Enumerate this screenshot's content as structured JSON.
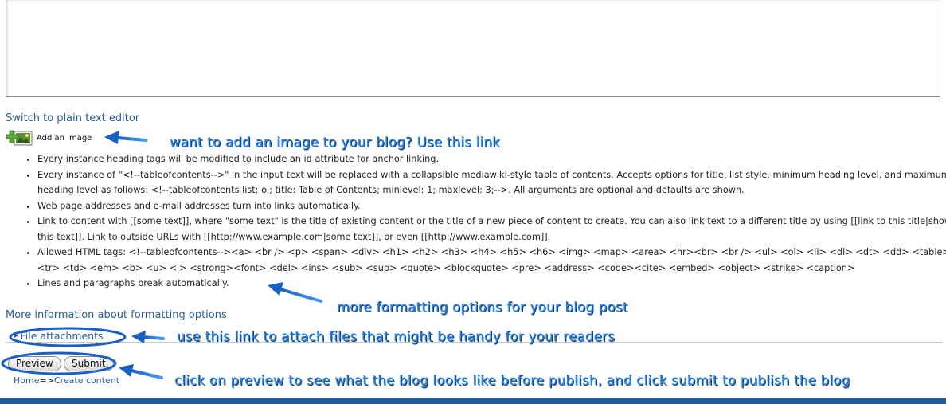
{
  "editor": {
    "switch_link": "Switch to plain text editor",
    "add_image_label": "Add an image"
  },
  "formatting_tips": [
    "Every instance heading tags will be modified to include an id attribute for anchor linking.",
    "Every instance of \"<!--tableofcontents-->\" in the input text will be replaced with a collapsible mediawiki-style table of contents. Accepts options for title, list style, minimum heading level, and maximum heading level as follows: <!--tableofcontents list: ol; title: Table of Contents; minlevel: 1; maxlevel: 3;-->. All arguments are optional and defaults are shown.",
    "Web page addresses and e-mail addresses turn into links automatically.",
    "Link to content with [[some text]], where \"some text\" is the title of existing content or the title of a new piece of content to create. You can also link text to a different title by using [[link to this title|show this text]]. Link to outside URLs with [[http://www.example.com|some text]], or even [[http://www.example.com]].",
    "Allowed HTML tags: <!--tableofcontents--><a> <br /> <p> <span> <div> <h1> <h2> <h3> <h4> <h5> <h6> <img> <map> <area> <hr><br> <br /> <ul> <ol> <li> <dl> <dt> <dd> <table> <tr> <td> <em> <b> <u> <i> <strong><font> <del> <ins> <sub> <sup> <quote> <blockquote> <pre> <address> <code><cite> <embed> <object> <strike> <caption>",
    "Lines and paragraphs break automatically."
  ],
  "more_info_link": "More information about formatting options",
  "attachments": {
    "label": "File attachments"
  },
  "buttons": {
    "preview": "Preview",
    "submit": "Submit"
  },
  "breadcrumb": {
    "home": "Home",
    "separator": "=>",
    "current": "Create content"
  },
  "annotations": {
    "add_image": "want to add an image to your blog?  Use this link",
    "formatting": "more formatting options for your blog post",
    "attachments": "use this link to attach files that might be handy for your readers",
    "publish": "click on preview to see what the blog looks like before publish, and click submit to publish the blog"
  },
  "colors": {
    "link": "#2b5f96",
    "annotation": "#2a82e0",
    "annotation_outline": "#1a5fc4",
    "bottom_bar": "#1f5a99"
  }
}
